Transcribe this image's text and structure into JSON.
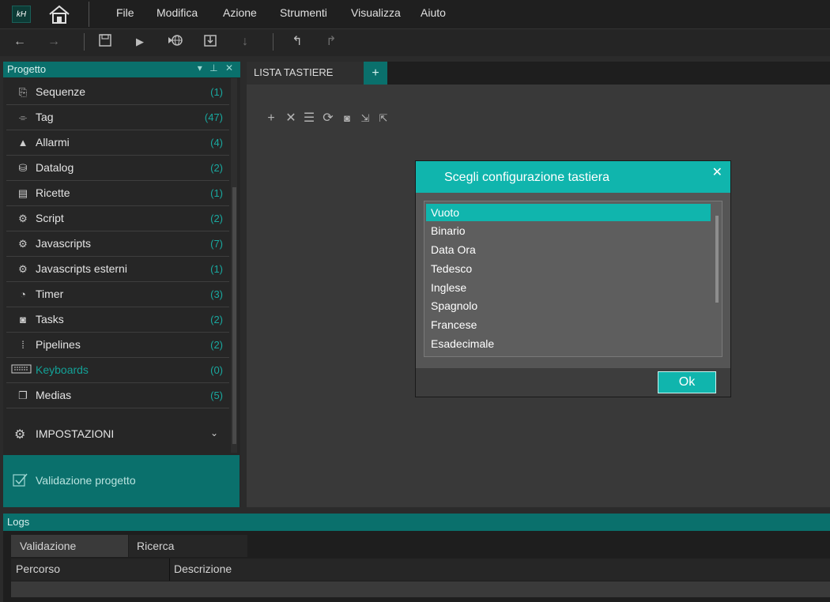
{
  "menubar": {
    "logo_text": "kH",
    "items": [
      "File",
      "Modifica",
      "Azione",
      "Strumenti",
      "Visualizza",
      "Aiuto"
    ]
  },
  "project_panel": {
    "title": "Progetto",
    "controls": "▾ ⊥ ✕",
    "items": [
      {
        "label": "Sequenze",
        "count": "(1)",
        "icon": "sequence-icon"
      },
      {
        "label": "Tag",
        "count": "(47)",
        "icon": "tag-icon"
      },
      {
        "label": "Allarmi",
        "count": "(4)",
        "icon": "alarm-icon"
      },
      {
        "label": "Datalog",
        "count": "(2)",
        "icon": "database-icon"
      },
      {
        "label": "Ricette",
        "count": "(1)",
        "icon": "recipe-icon"
      },
      {
        "label": "Script",
        "count": "(2)",
        "icon": "script-icon"
      },
      {
        "label": "Javascripts",
        "count": "(7)",
        "icon": "script-icon"
      },
      {
        "label": "Javascripts esterni",
        "count": "(1)",
        "icon": "script-icon"
      },
      {
        "label": "Timer",
        "count": "(3)",
        "icon": "timer-icon"
      },
      {
        "label": "Tasks",
        "count": "(2)",
        "icon": "task-icon"
      },
      {
        "label": "Pipelines",
        "count": "(2)",
        "icon": "pipeline-icon"
      },
      {
        "label": "Keyboards",
        "count": "(0)",
        "icon": "keyboard-icon",
        "active": true
      },
      {
        "label": "Medias",
        "count": "(5)",
        "icon": "media-icon"
      }
    ],
    "settings_label": "IMPOSTAZIONI",
    "validate_label": "Validazione progetto"
  },
  "editor": {
    "tab_label": "LISTA TASTIERE",
    "add_tab": "+"
  },
  "dialog": {
    "title": "Scegli configurazione tastiera",
    "options": [
      "Vuoto",
      "Binario",
      "Data Ora",
      "Tedesco",
      "Inglese",
      "Spagnolo",
      "Francese",
      "Esadecimale"
    ],
    "selected": "Vuoto",
    "ok_label": "Ok"
  },
  "logs": {
    "title": "Logs",
    "tabs": [
      "Validazione",
      "Ricerca"
    ],
    "columns": [
      "Percorso",
      "Descrizione"
    ]
  },
  "colors": {
    "accent": "#10b5ad",
    "accent_dark": "#0a706c",
    "active_text": "#13a197"
  }
}
